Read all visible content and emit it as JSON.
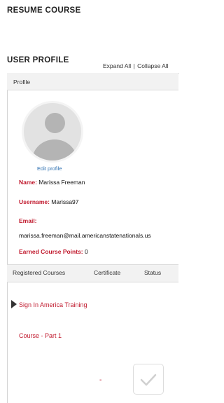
{
  "header": {
    "resume_course": "RESUME COURSE",
    "user_profile": "USER PROFILE",
    "expand_all": "Expand All",
    "separator": "|",
    "collapse_all": "Collapse All"
  },
  "profile_panel": {
    "title": "Profile",
    "edit_profile": "Edit profile",
    "name_label": "Name:",
    "name_value": " Marissa Freeman",
    "username_label": "Username:",
    "username_value": " Marissa97",
    "email_label": "Email:",
    "email_value": "marissa.freeman@mail.americanstatenationals.us",
    "points_label": "Earned Course Points:",
    "points_value": " 0"
  },
  "tabs": {
    "registered_courses": "Registered Courses",
    "certificate": "Certificate",
    "status": "Status"
  },
  "courses": {
    "course_title": "Sign In America Training",
    "module_title": "Course - Part 1",
    "certificate_value": "-"
  },
  "colors": {
    "accent_red": "#c0182c",
    "link_blue": "#2c6fb0"
  }
}
